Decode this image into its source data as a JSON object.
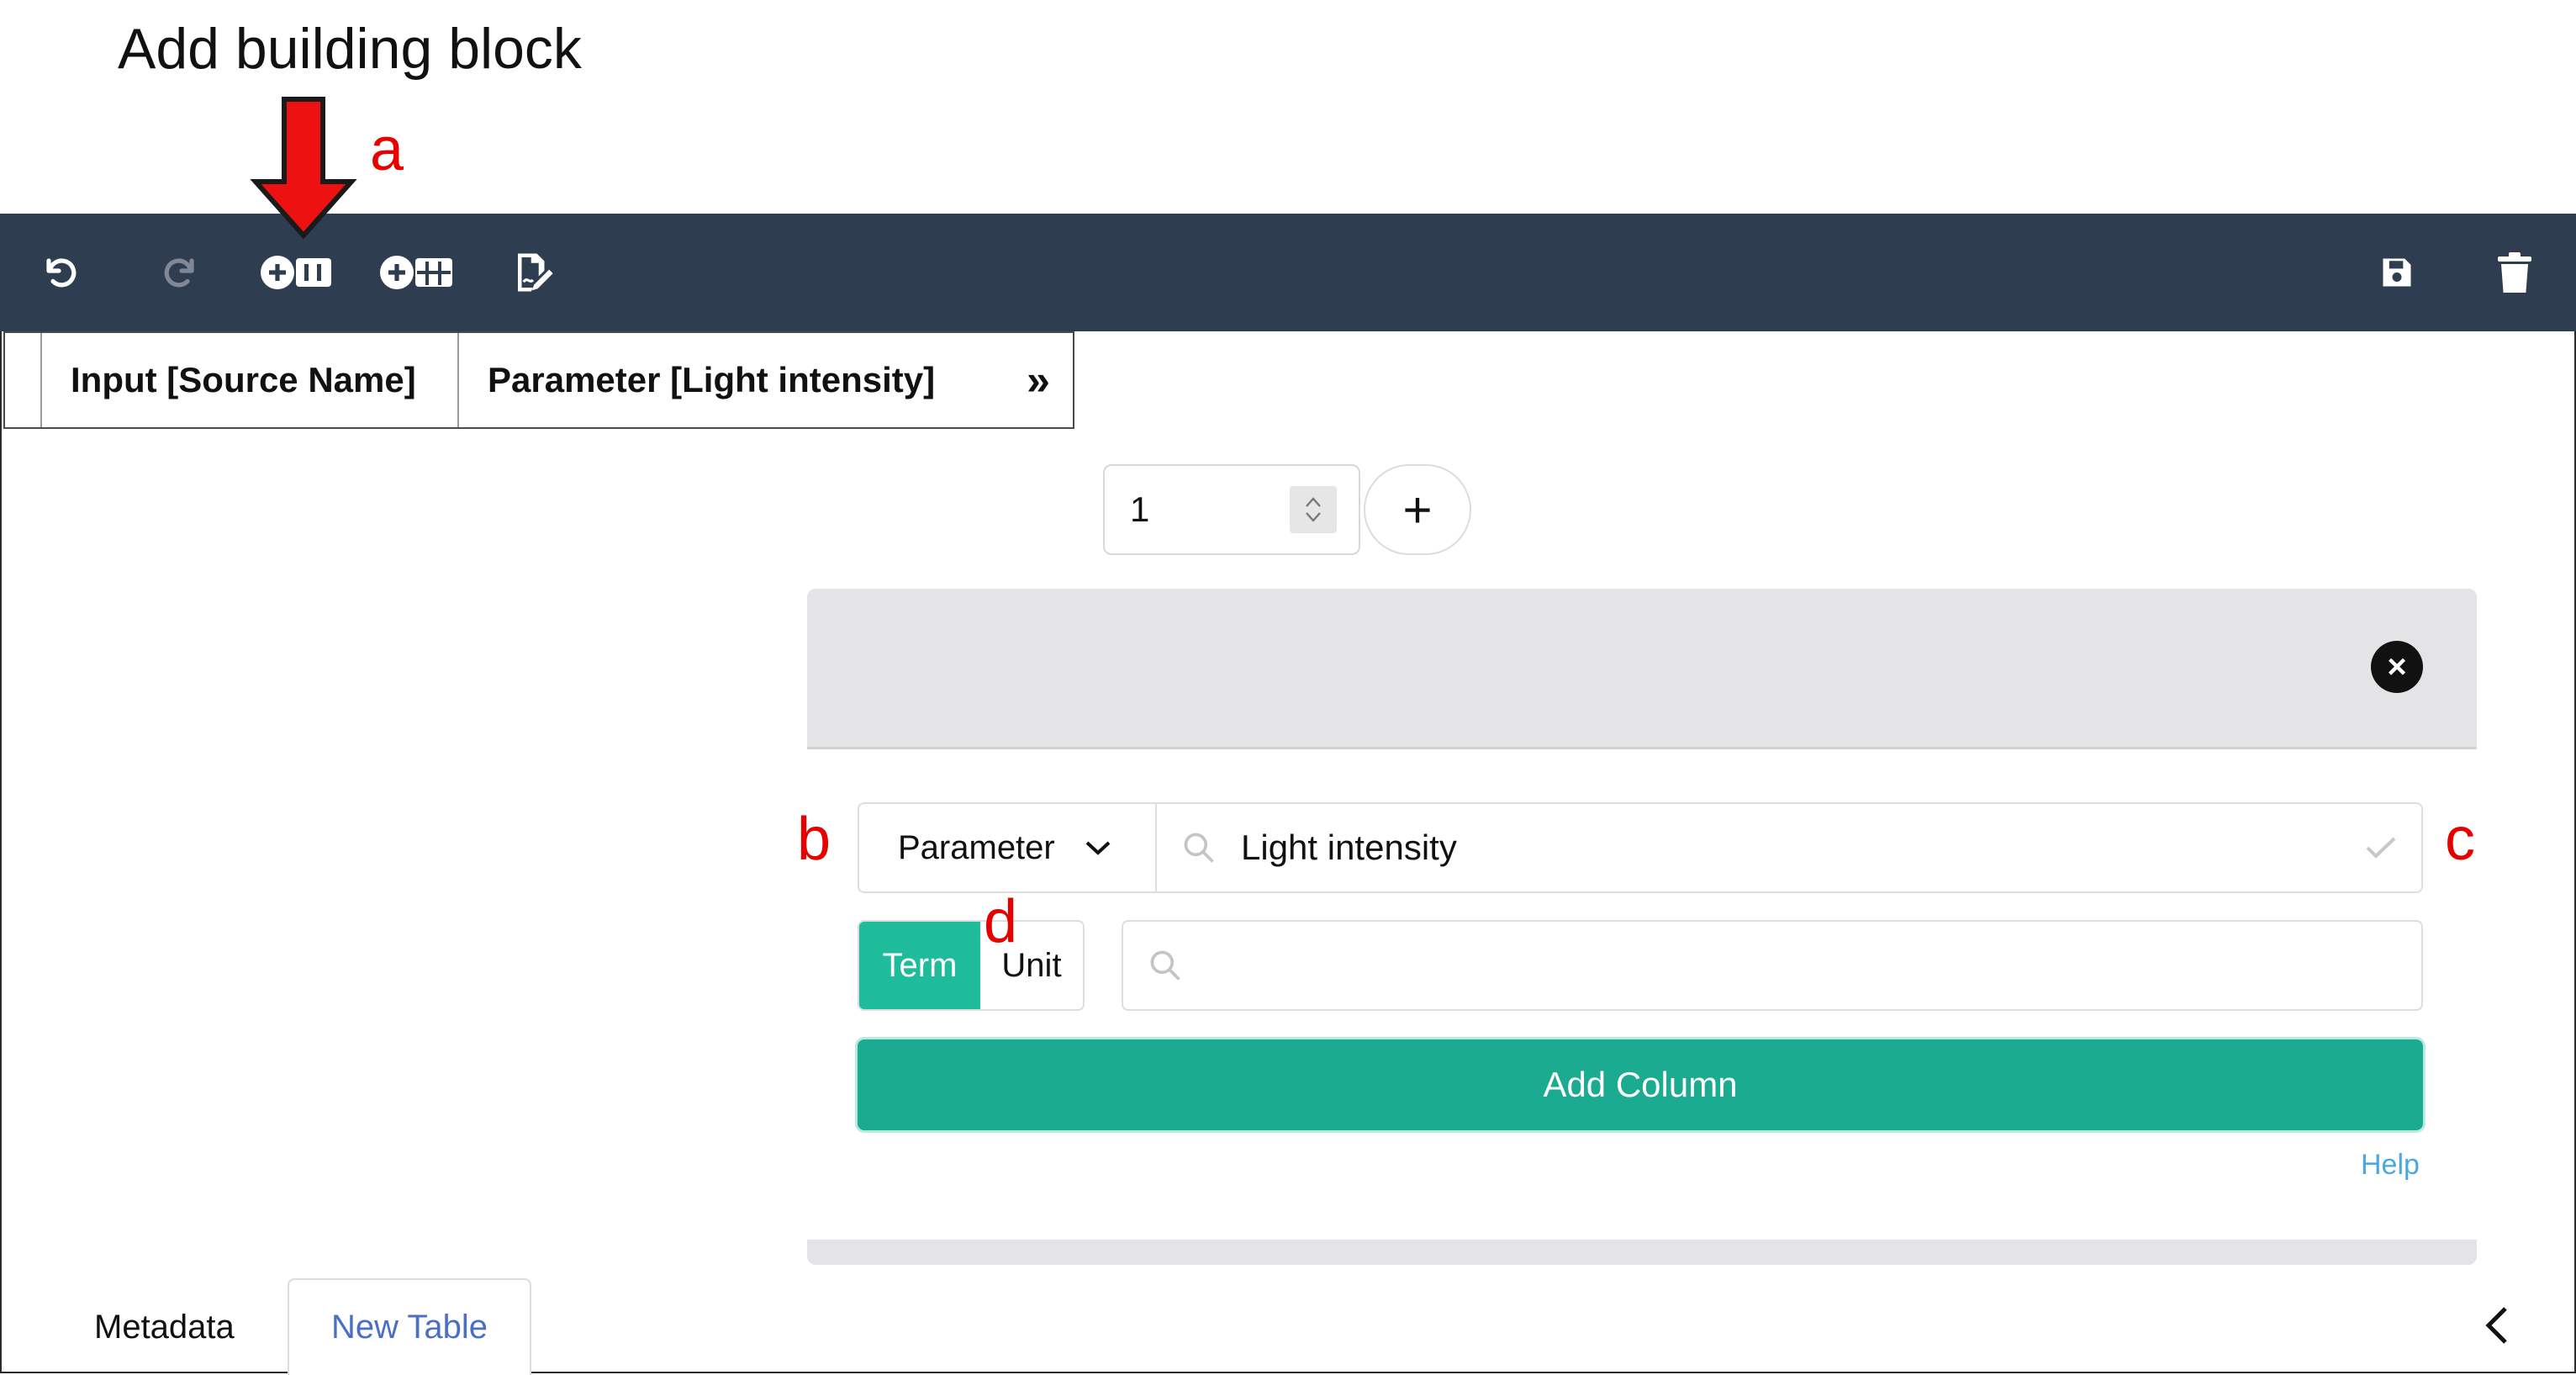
{
  "annotation": {
    "title": "Add building block",
    "labels": {
      "a": "a",
      "b": "b",
      "c": "c",
      "d": "d"
    }
  },
  "toolbar": {
    "icons": [
      "undo-icon",
      "redo-icon",
      "add-building-block-icon",
      "add-template-icon",
      "edit-icon",
      "save-icon",
      "delete-icon"
    ]
  },
  "table": {
    "columns": [
      "Input [Source Name]",
      "Parameter [Light intensity]"
    ],
    "expand_icon": "»"
  },
  "rows_stepper": {
    "value": "1",
    "add_label": "+"
  },
  "builder": {
    "type_select": "Parameter",
    "term_value": "Light intensity",
    "toggle": {
      "term": "Term",
      "unit": "Unit",
      "active": "Term"
    },
    "unit_placeholder": "",
    "add_column_label": "Add Column",
    "help_label": "Help"
  },
  "tabs": {
    "metadata": "Metadata",
    "new_table": "New Table"
  },
  "colors": {
    "toolbar_bg": "#2e3e50",
    "accent": "#1bab90",
    "annotation": "#e60000"
  }
}
